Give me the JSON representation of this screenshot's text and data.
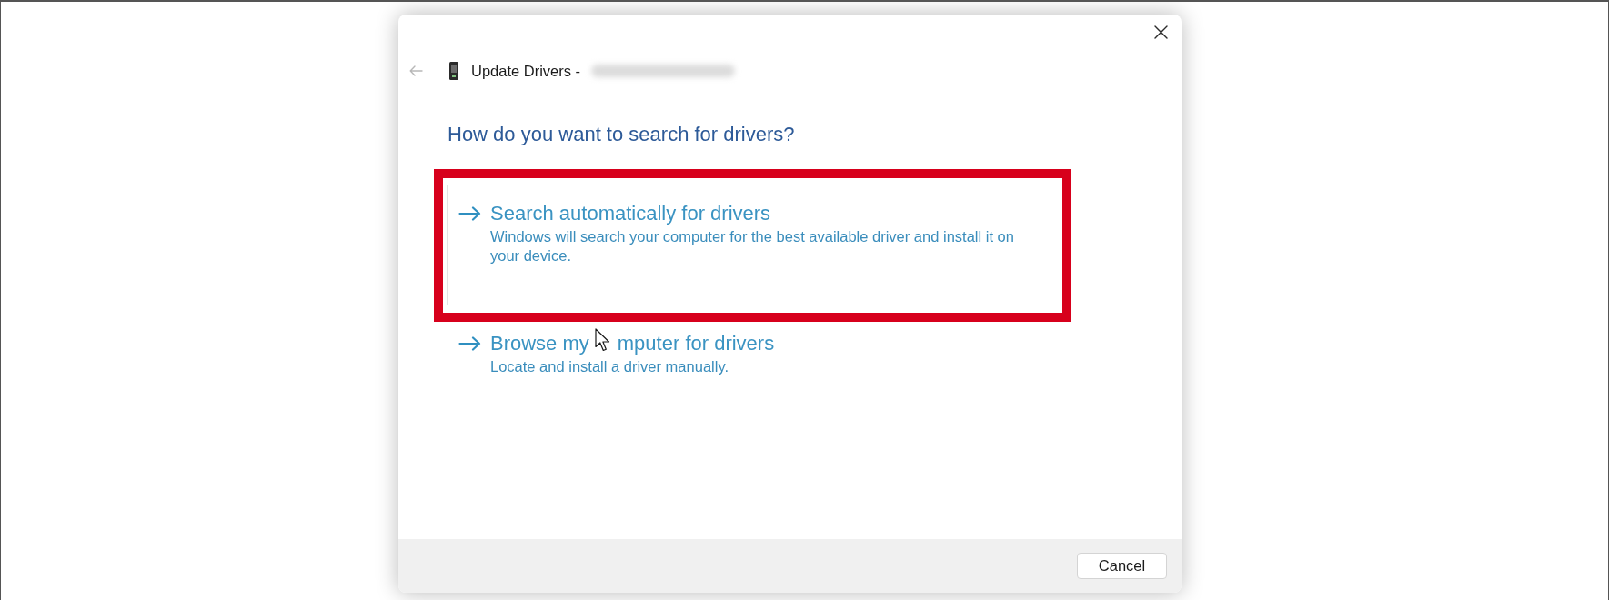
{
  "dialog": {
    "back_button": {
      "disabled": true
    },
    "title": "Update Drivers -",
    "device_name_redacted": true,
    "heading": "How do you want to search for drivers?"
  },
  "options": [
    {
      "title_parts": [
        "Search automatically for drivers"
      ],
      "description": "Windows will search your computer for the best available driver and install it on your device.",
      "highlighted": true
    },
    {
      "title_parts": [
        "Browse my",
        "mputer for drivers"
      ],
      "description": "Locate and install a driver manually.",
      "highlighted": false
    }
  ],
  "buttons": [
    {
      "label": "Cancel"
    }
  ]
}
